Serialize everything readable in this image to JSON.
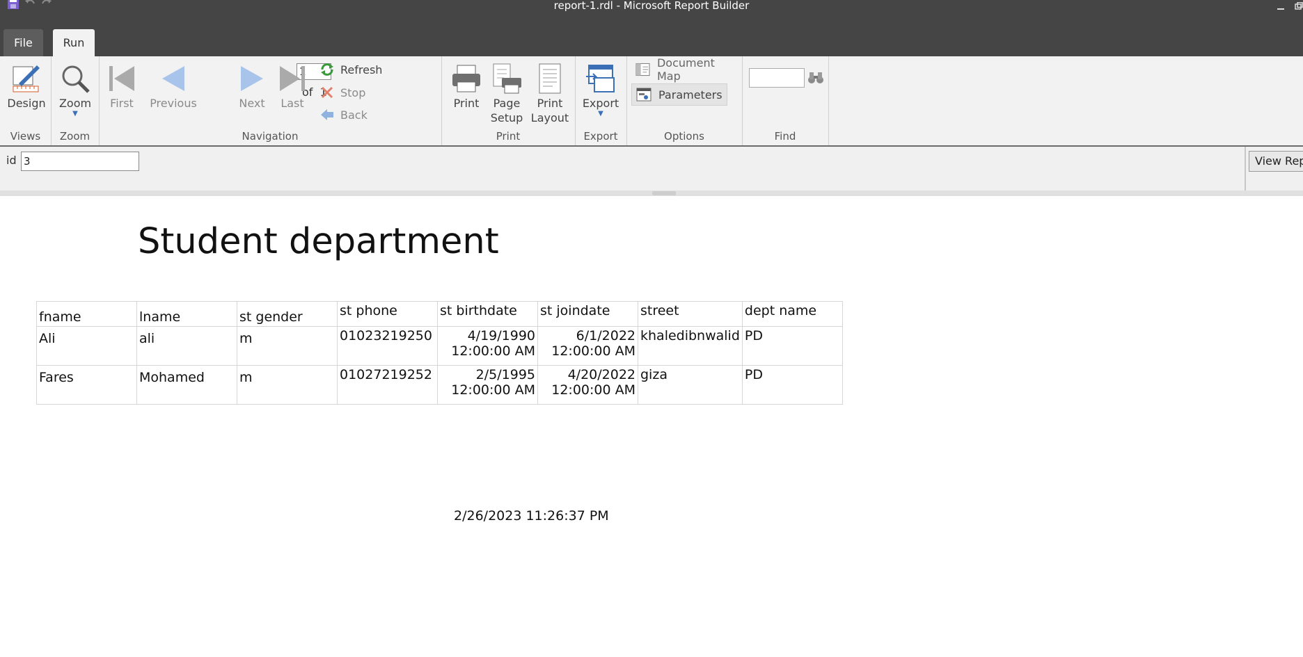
{
  "window": {
    "title": "report-1.rdl - Microsoft Report Builder"
  },
  "tabs": {
    "file": "File",
    "run": "Run"
  },
  "ribbon": {
    "views": {
      "design": "Design",
      "label": "Views"
    },
    "zoom": {
      "zoom": "Zoom",
      "label": "Zoom"
    },
    "navigation": {
      "first": "First",
      "previous": "Previous",
      "page_value": "1",
      "of": "of",
      "total_pages": "1",
      "next": "Next",
      "last": "Last",
      "refresh": "Refresh",
      "stop": "Stop",
      "back": "Back",
      "label": "Navigation"
    },
    "print": {
      "print": "Print",
      "page_setup_1": "Page",
      "page_setup_2": "Setup",
      "print_layout_1": "Print",
      "print_layout_2": "Layout",
      "label": "Print"
    },
    "export": {
      "export": "Export",
      "label": "Export"
    },
    "options": {
      "document_map": "Document Map",
      "parameters": "Parameters",
      "label": "Options"
    },
    "find": {
      "label": "Find"
    }
  },
  "parameters": {
    "id_label": "id",
    "id_value": "3",
    "view_report": "View Report"
  },
  "report": {
    "title": "Student department",
    "columns": [
      "fname",
      "lname",
      "st gender",
      "st phone",
      "st birthdate",
      "st joindate",
      "street",
      "dept name"
    ],
    "rows": [
      {
        "fname": "Ali",
        "lname": "ali",
        "gender": "m",
        "phone": "01023219250",
        "birth_date": "4/19/1990",
        "birth_time": "12:00:00 AM",
        "join_date": "6/1/2022",
        "join_time": "12:00:00 AM",
        "street": "khaledibnwalid",
        "dept": "PD"
      },
      {
        "fname": "Fares",
        "lname": "Mohamed",
        "gender": "m",
        "phone": "01027219252",
        "birth_date": "2/5/1995",
        "birth_time": "12:00:00 AM",
        "join_date": "4/20/2022",
        "join_time": "12:00:00 AM",
        "street": "giza",
        "dept": "PD"
      }
    ],
    "execution_time": "2/26/2023 11:26:37 PM"
  }
}
